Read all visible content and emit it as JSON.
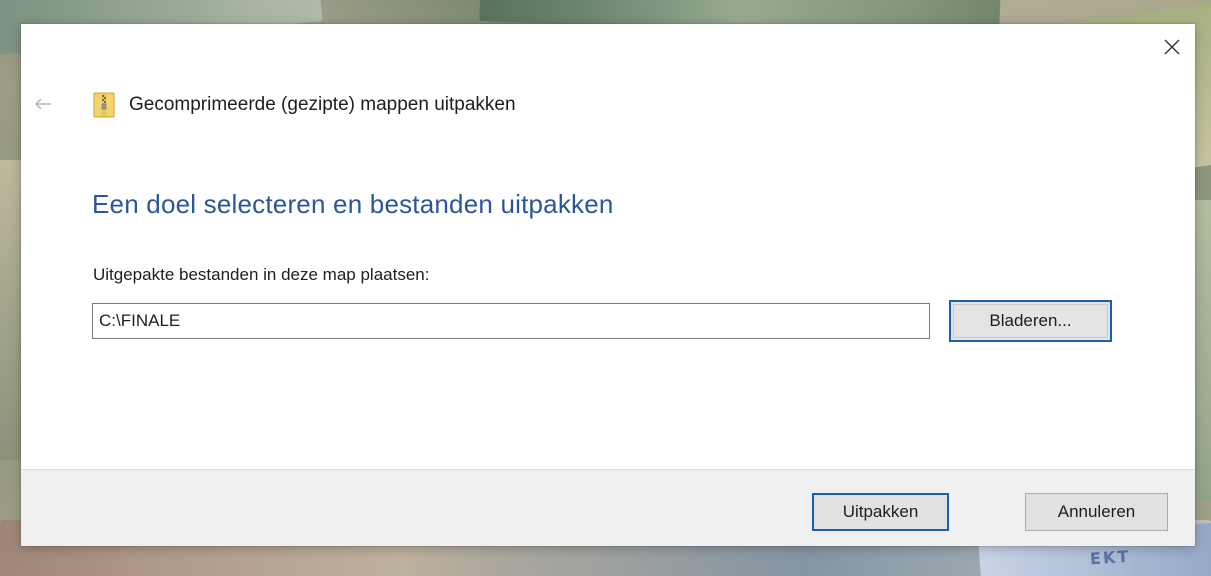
{
  "dialog": {
    "header_title": "Gecomprimeerde (gezipte) mappen uitpakken",
    "main_instruction": "Een doel selecteren en bestanden uitpakken",
    "field_label": "Uitgepakte bestanden in deze map plaatsen:",
    "path_value": "C:\\FINALE",
    "browse_label": "Bladeren...",
    "extract_label": "Uitpakken",
    "cancel_label": "Annuleren"
  },
  "icons": {
    "close": "close-icon",
    "back": "back-arrow-icon",
    "zip_folder": "zip-folder-icon"
  },
  "colors": {
    "accent": "#1a5fa8",
    "instruction_text": "#2b5797",
    "footer_bg": "#f0f0f0"
  },
  "background": {
    "banknote_text": "EKT"
  }
}
